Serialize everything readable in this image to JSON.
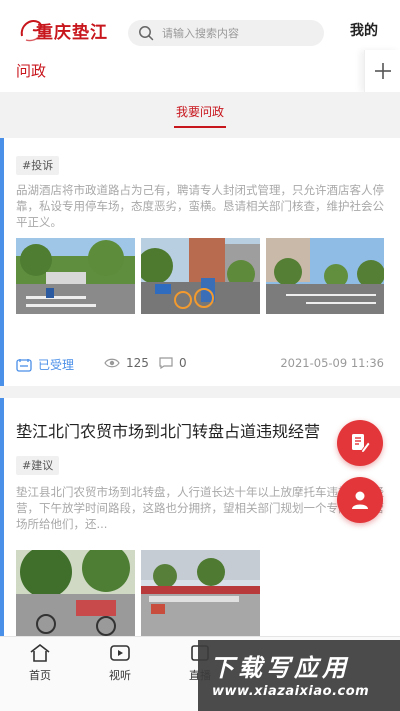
{
  "header": {
    "logo_text": "重庆垫江",
    "search_placeholder": "请输入搜索内容",
    "mine_label": "我的"
  },
  "subbar": {
    "title": "问政"
  },
  "tabs": {
    "active_label": "我要问政"
  },
  "posts": [
    {
      "tag": "#投诉",
      "description": "品湖酒店将市政道路占为己有，聘请专人封闭式管理，只允许酒店客人停靠，私设专用停车场，态度恶劣，蛮横。恳请相关部门核查，维护社会公平正义。",
      "status": "已受理",
      "views": "125",
      "comments": "0",
      "datetime": "2021-05-09 11:36"
    },
    {
      "title": "垫江北门农贸市场到北门转盘占道违规经营",
      "tag": "#建议",
      "description": "垫江县北门农贸市场到北转盘，人行道长达十年以上放摩托车违规占道经营，下午放学时间路段，这路也分拥挤，望相关部门规划一个专门的经营场所给他们，还..."
    }
  ],
  "bottom_nav": {
    "items": [
      "首页",
      "视听",
      "直播"
    ]
  },
  "watermark": {
    "line1": "下载写应用",
    "line2": "www.xiazaixiao.com"
  },
  "colors": {
    "brand_red": "#c8161d",
    "accent_blue": "#4a8fe8",
    "fab_red": "#e2363a"
  },
  "icons": [
    "search-icon",
    "plus-icon",
    "status-icon",
    "eye-icon",
    "comment-icon",
    "edit-icon",
    "user-icon",
    "home-icon",
    "play-icon",
    "live-icon"
  ]
}
